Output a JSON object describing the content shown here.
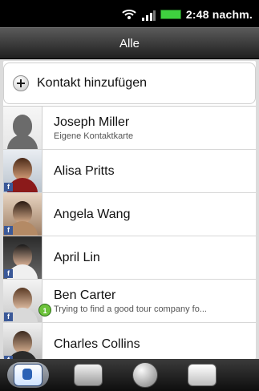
{
  "status_bar": {
    "time": "2:48 nachm.",
    "icons": [
      "wifi-icon",
      "signal-icon",
      "battery-icon"
    ]
  },
  "title_bar": {
    "title": "Alle"
  },
  "add_contact": {
    "label": "Kontakt hinzufügen",
    "icon": "add-icon"
  },
  "contacts": [
    {
      "name": "Joseph Miller",
      "subtitle": "Eigene Kontaktkarte",
      "avatar": "generic-person-icon",
      "source": ""
    },
    {
      "name": "Alisa Pritts",
      "subtitle": "",
      "avatar": "photo",
      "source": "f"
    },
    {
      "name": "Angela Wang",
      "subtitle": "",
      "avatar": "photo",
      "source": "f"
    },
    {
      "name": "April  Lin",
      "subtitle": "",
      "avatar": "photo",
      "source": "f"
    },
    {
      "name": "Ben  Carter",
      "subtitle": "Trying to find a good tour company fo...",
      "avatar": "photo",
      "source": "f",
      "badge": "1"
    },
    {
      "name": "Charles  Collins",
      "subtitle": "",
      "avatar": "photo",
      "source": "f"
    }
  ],
  "bottom_tabs": [
    {
      "name": "people-tab",
      "icon": "contacts-icon",
      "active": true
    },
    {
      "name": "groups-tab",
      "icon": "groups-icon",
      "active": false
    },
    {
      "name": "online-directories-tab",
      "icon": "globe-icon",
      "active": false
    },
    {
      "name": "call-history-tab",
      "icon": "call-history-icon",
      "active": false
    }
  ],
  "colors": {
    "status_bar_bg": "#000000",
    "title_bar_bg": "#2a2a2a",
    "list_bg": "#ffffff",
    "facebook_blue": "#3b5998",
    "badge_green": "#6cc23a"
  }
}
